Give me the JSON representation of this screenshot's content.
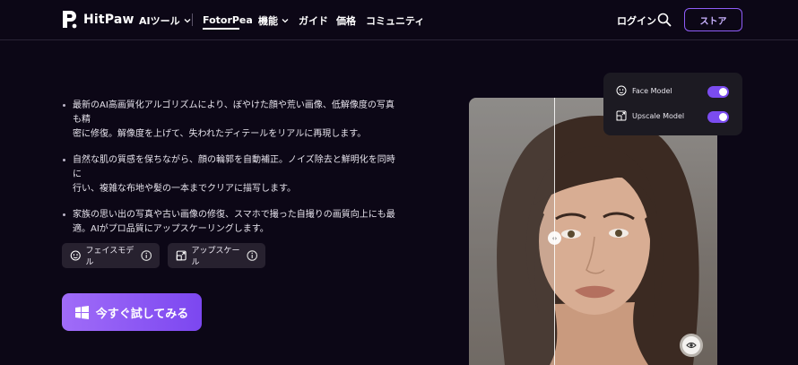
{
  "header": {
    "logo_text": "HitPaw",
    "nav": [
      {
        "label": "AIツール",
        "has_dropdown": true
      },
      {
        "label": "FotorPea",
        "active": true
      },
      {
        "label": "機能",
        "has_dropdown": true
      },
      {
        "label": "ガイド"
      },
      {
        "label": "価格"
      },
      {
        "label": "コミュニティ"
      }
    ],
    "login_label": "ログイン",
    "search_icon": "search-icon",
    "store_label": "ストア"
  },
  "bullets": [
    {
      "line1": "最新のAI高画質化アルゴリズムにより、ぼやけた顔や荒い画像、低解像度の写真も精",
      "line2": "密に修復。解像度を上げて、失われたディテールをリアルに再現します。"
    },
    {
      "line1": "自然な肌の質感を保ちながら、顔の輪郭を自動補正。ノイズ除去と鮮明化を同時に",
      "line2": "行い、複雑な布地や髪の一本までクリアに描写します。"
    },
    {
      "line1": "家族の思い出の写真や古い画像の修復、スマホで撮った自撮りの画質向上にも最",
      "line2": "適。AIがプロ品質にアップスケーリングします。"
    }
  ],
  "chips": [
    {
      "label": "フェイスモデル",
      "icon": "face-icon"
    },
    {
      "label": "アップスケール",
      "icon": "upscale-icon"
    }
  ],
  "cta": {
    "label": "今すぐ試してみる",
    "icon": "windows-icon"
  },
  "panel": {
    "face_model": {
      "label": "Face Model",
      "enabled": true
    },
    "upscale_model": {
      "label": "Upscale Model",
      "enabled": true
    }
  },
  "compare_handle_glyph": "‹›",
  "colors": {
    "background": "#0c0716",
    "accent": "#8e5cf7",
    "toggle_on": "#7b4cf0",
    "cta_start": "#a06cf8",
    "cta_end": "#7c47f0"
  }
}
